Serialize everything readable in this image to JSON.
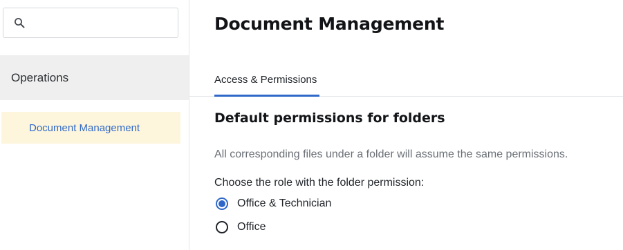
{
  "sidebar": {
    "search": {
      "placeholder": "",
      "value": "",
      "icon": "search-icon"
    },
    "section_label": "Operations",
    "active_item_label": "Document Management"
  },
  "main": {
    "title": "Document Management",
    "tabs": [
      {
        "label": "Access & Permissions",
        "selected": true
      }
    ],
    "section_heading": "Default permissions for folders",
    "description": "All corresponding files under a folder will assume the same permissions.",
    "question": "Choose the role with the folder permission:",
    "options": [
      {
        "label": "Office & Technician",
        "selected": true
      },
      {
        "label": "Office",
        "selected": false
      }
    ]
  },
  "colors": {
    "accent": "#2f68c8",
    "active_nav_background": "#fdf6dd",
    "section_background": "#efefef",
    "muted_text": "#6b7076"
  }
}
